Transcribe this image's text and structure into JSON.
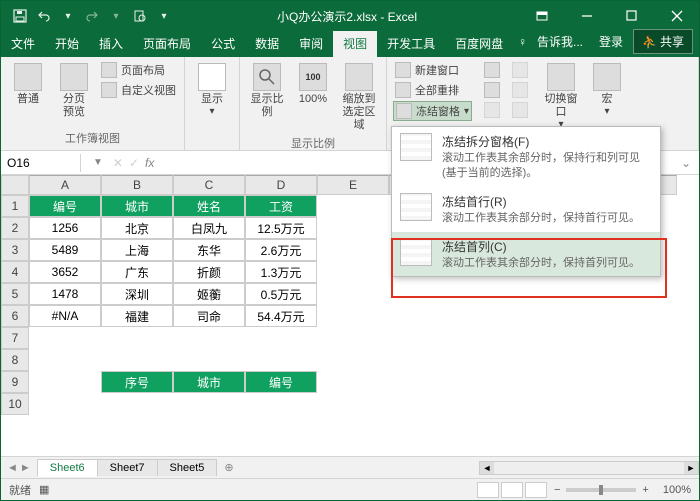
{
  "titlebar": {
    "title": "小Q办公演示2.xlsx - Excel"
  },
  "menu": {
    "tabs": [
      "文件",
      "开始",
      "插入",
      "页面布局",
      "公式",
      "数据",
      "审阅",
      "视图",
      "开发工具",
      "百度网盘"
    ],
    "active": 7,
    "tell": "告诉我...",
    "login": "登录",
    "share": "共享"
  },
  "ribbon": {
    "g1": {
      "label": "工作簿视图",
      "normal": "普通",
      "preview": "分页\n预览",
      "layout": "页面布局",
      "custom": "自定义视图"
    },
    "g2": {
      "label": "显示",
      "show": "显示"
    },
    "g3": {
      "label": "显示比例",
      "ratio": "显示比例",
      "hundred": "100%",
      "zoomsel": "缩放到\n选定区域"
    },
    "g4": {
      "newwin": "新建窗口",
      "arrange": "全部重排",
      "freeze": "冻结窗格"
    },
    "g5": {
      "switch": "切换窗口"
    },
    "g6": {
      "macro": "宏"
    }
  },
  "namebox": "O16",
  "cols": [
    "A",
    "B",
    "C",
    "D",
    "E"
  ],
  "headers": [
    "编号",
    "城市",
    "姓名",
    "工资"
  ],
  "rows": [
    [
      "1256",
      "北京",
      "白凤九",
      "12.5万元"
    ],
    [
      "5489",
      "上海",
      "东华",
      "2.6万元"
    ],
    [
      "3652",
      "广东",
      "折颜",
      "1.3万元"
    ],
    [
      "1478",
      "深圳",
      "姬蘅",
      "0.5万元"
    ],
    [
      "#N/A",
      "福建",
      "司命",
      "54.4万元"
    ]
  ],
  "headers2": [
    "序号",
    "城市",
    "编号"
  ],
  "sheets": [
    "Sheet6",
    "Sheet7",
    "Sheet5"
  ],
  "status": {
    "ready": "就绪",
    "zoom": "100%"
  },
  "dropdown": {
    "i1": {
      "t": "冻结拆分窗格(F)",
      "d": "滚动工作表其余部分时，保持行和列可见(基于当前的选择)。"
    },
    "i2": {
      "t": "冻结首行(R)",
      "d": "滚动工作表其余部分时，保持首行可见。"
    },
    "i3": {
      "t": "冻结首列(C)",
      "d": "滚动工作表其余部分时，保持首列可见。"
    }
  }
}
